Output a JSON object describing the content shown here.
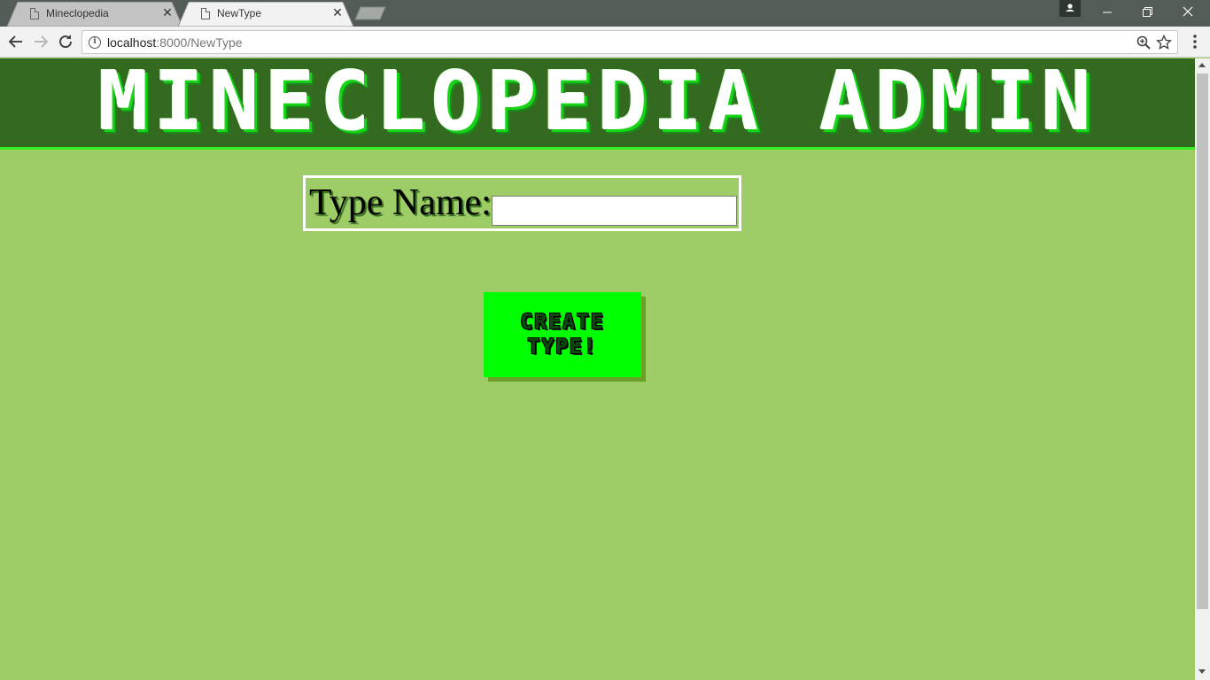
{
  "browser": {
    "tabs": [
      {
        "title": "Mineclopedia",
        "active": false
      },
      {
        "title": "NewType",
        "active": true
      }
    ],
    "address": {
      "host": "localhost",
      "path": ":8000/NewType"
    }
  },
  "page": {
    "banner_title": "MINECLOPEDIA ADMIN",
    "form": {
      "label": "Type Name:",
      "input_value": ""
    },
    "create_button_label": "CREATE\nTYPE!"
  },
  "colors": {
    "page_bg": "#9ecd68",
    "banner_bg": "#336a1f",
    "banner_border": "#33ee22",
    "button_bg": "#00ff00"
  },
  "icons": {
    "back": "back-arrow-icon",
    "forward": "forward-arrow-icon",
    "reload": "reload-icon",
    "info": "info-icon",
    "zoom": "zoom-icon",
    "bookmark": "star-icon",
    "menu": "kebab-menu-icon"
  }
}
